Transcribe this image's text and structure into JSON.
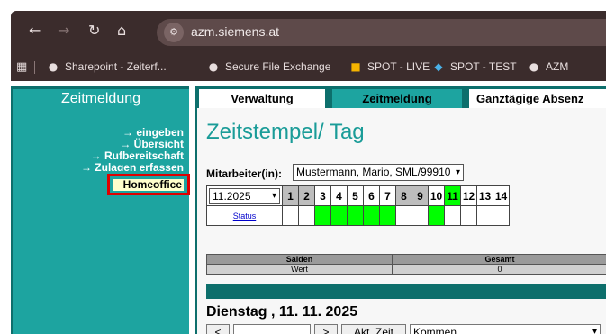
{
  "browser": {
    "url": "azm.siemens.at",
    "nav_icons": [
      "back-arrow",
      "forward-arrow",
      "reload",
      "home",
      "site-settings"
    ],
    "bookmarks": [
      {
        "label": "Sharepoint - Zeiterf...",
        "icon": "globe"
      },
      {
        "label": "Secure File Exchange",
        "icon": "globe"
      },
      {
        "label": "SPOT - LIVE",
        "icon": "windows-logo"
      },
      {
        "label": "SPOT - TEST",
        "icon": "diamond"
      },
      {
        "label": "AZM",
        "icon": "globe"
      }
    ]
  },
  "sidebar": {
    "title": "Zeitmeldung",
    "links": [
      "→ eingeben",
      "→ Übersicht",
      "→ Rufbereitschaft",
      "→ Zulagen erfassen"
    ],
    "highlighted": "Homeoffice"
  },
  "tabs": [
    {
      "label": "Verwaltung",
      "active": false
    },
    {
      "label": "Zeitmeldung",
      "active": true
    },
    {
      "label": "Ganztägige Absenz",
      "active": false
    }
  ],
  "main": {
    "title": "Zeitstempel/ Tag",
    "employee_label": "Mitarbeiter(in):",
    "employee_value": "Mustermann, Mario, SML/99910",
    "month_value": "11.2025",
    "status_link": "Status",
    "days": [
      "1",
      "2",
      "3",
      "4",
      "5",
      "6",
      "7",
      "8",
      "9",
      "10",
      "11",
      "12",
      "13",
      "14"
    ],
    "weekend_days": [
      "1",
      "2",
      "8",
      "9"
    ],
    "selected_day": "11",
    "green_days_in_status_row": [
      "3",
      "4",
      "5",
      "6",
      "7",
      "10"
    ],
    "saldo_headers": [
      "Salden",
      "Gesamt"
    ],
    "saldo_values": [
      "Wert",
      "0"
    ],
    "date_heading": "Dienstag , 11. 11. 2025",
    "buttons": {
      "prev": "<",
      "next": ">",
      "now": "Akt. Zeit"
    },
    "booking_type": "Kommen"
  },
  "colors": {
    "teal": "#1da4a0",
    "dark_teal": "#0d6f6c",
    "highlight_border": "#e00000",
    "green": "#00ff00",
    "chrome": "#3b2c2c"
  }
}
